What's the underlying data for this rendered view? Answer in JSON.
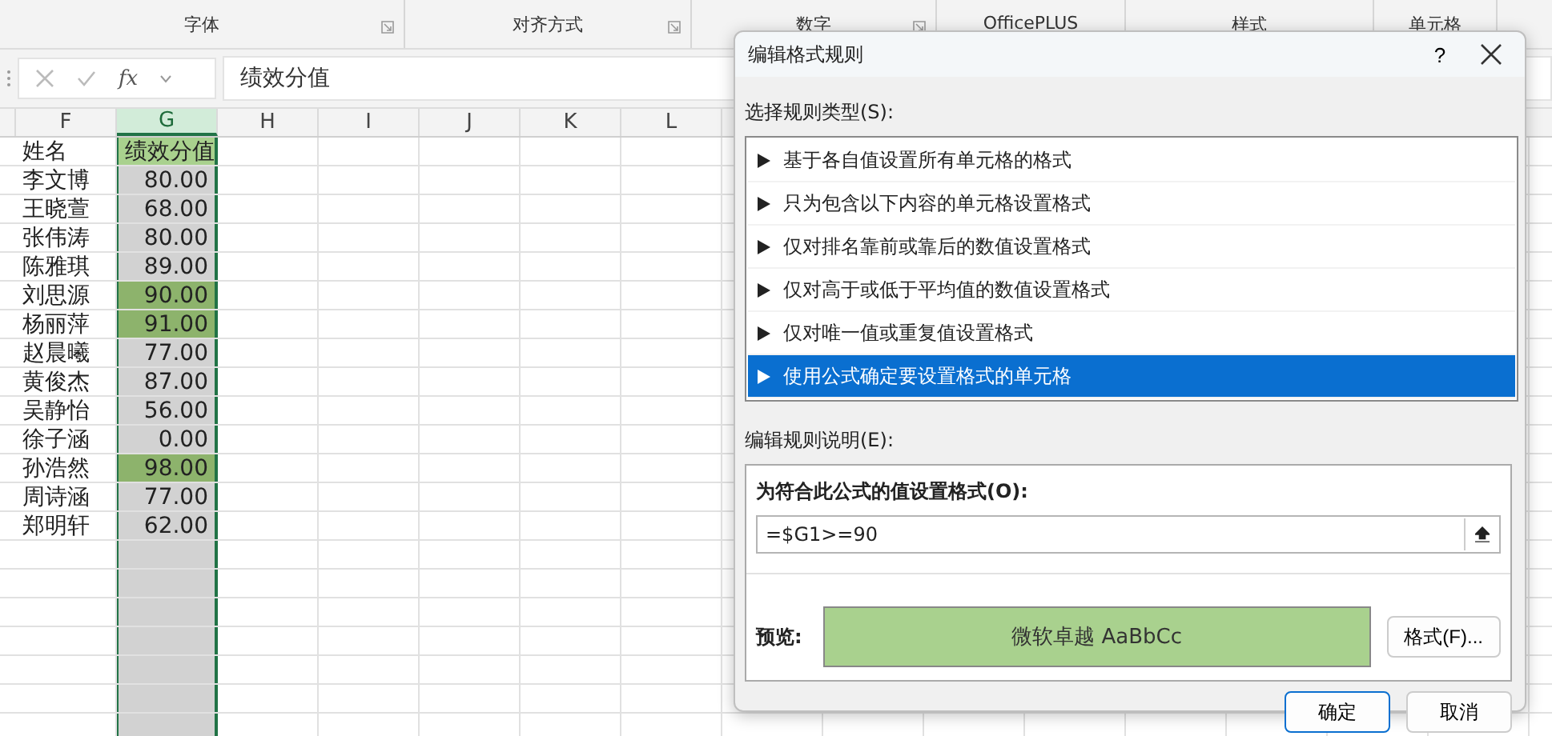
{
  "ribbon_groups": [
    {
      "label": "字体",
      "launcher": true
    },
    {
      "label": "对齐方式",
      "launcher": true
    },
    {
      "label": "数字",
      "launcher": true
    },
    {
      "label": "OfficePLUS",
      "launcher": false
    },
    {
      "label": "样式",
      "launcher": false
    },
    {
      "label": "单元格",
      "launcher": false
    }
  ],
  "formula_bar": {
    "function_label": "fx",
    "value": "绩效分值"
  },
  "columns": [
    {
      "label": "F",
      "selected": false
    },
    {
      "label": "G",
      "selected": true
    },
    {
      "label": "H",
      "selected": false
    },
    {
      "label": "I",
      "selected": false
    },
    {
      "label": "J",
      "selected": false
    },
    {
      "label": "K",
      "selected": false
    },
    {
      "label": "L",
      "selected": false
    }
  ],
  "sheet": {
    "header": {
      "name": "姓名",
      "score": "绩效分值"
    },
    "rows": [
      {
        "name": "李文博",
        "score": "80.00",
        "highlighted": false
      },
      {
        "name": "王晓萱",
        "score": "68.00",
        "highlighted": false
      },
      {
        "name": "张伟涛",
        "score": "80.00",
        "highlighted": false
      },
      {
        "name": "陈雅琪",
        "score": "89.00",
        "highlighted": false
      },
      {
        "name": "刘思源",
        "score": "90.00",
        "highlighted": true
      },
      {
        "name": "杨丽萍",
        "score": "91.00",
        "highlighted": true
      },
      {
        "name": "赵晨曦",
        "score": "77.00",
        "highlighted": false
      },
      {
        "name": "黄俊杰",
        "score": "87.00",
        "highlighted": false
      },
      {
        "name": "吴静怡",
        "score": "56.00",
        "highlighted": false
      },
      {
        "name": "徐子涵",
        "score": "0.00",
        "highlighted": false
      },
      {
        "name": "孙浩然",
        "score": "98.00",
        "highlighted": true
      },
      {
        "name": "周诗涵",
        "score": "77.00",
        "highlighted": false
      },
      {
        "name": "郑明轩",
        "score": "62.00",
        "highlighted": false
      }
    ]
  },
  "dialog": {
    "title": "编辑格式规则",
    "help": "?",
    "rule_type_label": "选择规则类型(S):",
    "rule_types": [
      {
        "label": "基于各自值设置所有单元格的格式",
        "selected": false
      },
      {
        "label": "只为包含以下内容的单元格设置格式",
        "selected": false
      },
      {
        "label": "仅对排名靠前或靠后的数值设置格式",
        "selected": false
      },
      {
        "label": "仅对高于或低于平均值的数值设置格式",
        "selected": false
      },
      {
        "label": "仅对唯一值或重复值设置格式",
        "selected": false
      },
      {
        "label": "使用公式确定要设置格式的单元格",
        "selected": true
      }
    ],
    "description_label": "编辑规则说明(E):",
    "formula_label": "为符合此公式的值设置格式(O):",
    "formula": "=$G1>=90",
    "preview_label": "预览:",
    "preview_text": "微软卓越  AaBbCc",
    "format_button": "格式(F)...",
    "buttons": [
      "确定",
      "取消"
    ]
  }
}
